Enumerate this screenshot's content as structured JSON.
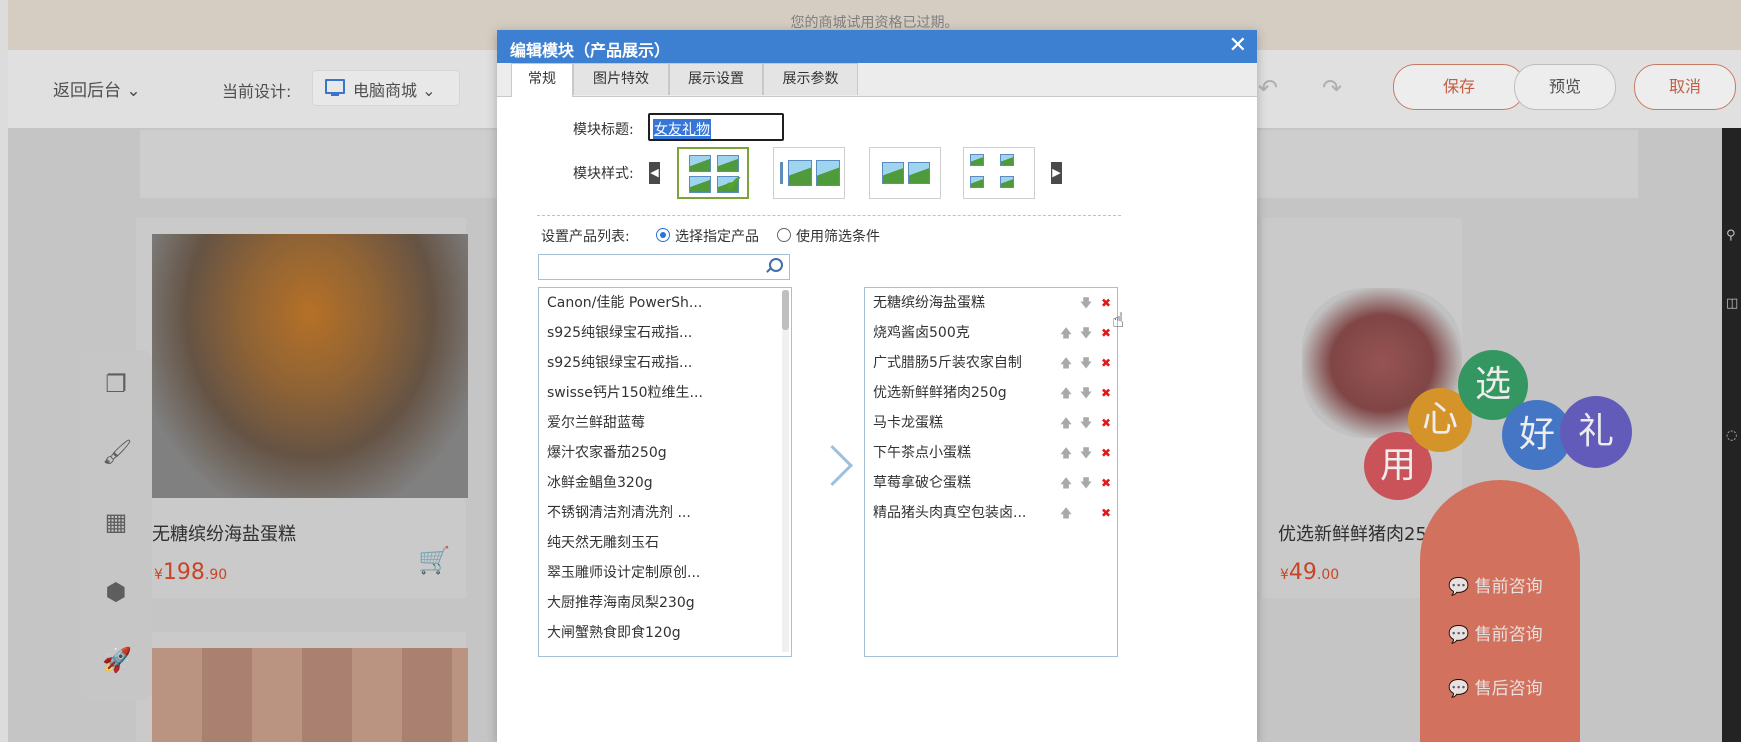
{
  "notice": {
    "text": "您的商城试用资格已过期。"
  },
  "editor_bar": {
    "back_label": "返回后台 ⌄",
    "current_design_label": "当前设计:",
    "device_label": "电脑商城 ⌄",
    "undo": "↶",
    "redo": "↷",
    "save_label": "保存",
    "preview_label": "预览",
    "cancel_label": "取消"
  },
  "background_products": [
    {
      "name": "无糖缤纷海盐蛋糕",
      "currency": "¥",
      "price_int": "198",
      "price_dec": ".90"
    },
    {
      "name": "优选新鲜鲜猪肉25",
      "currency": "¥",
      "price_int": "49",
      "price_dec": ".00"
    }
  ],
  "balloons": [
    "用",
    "心",
    "选",
    "好",
    "礼"
  ],
  "consult_items": [
    "售前咨询",
    "售前咨询",
    "售后咨询"
  ],
  "dialog": {
    "title": "编辑模块（产品展示）",
    "close_label": "✕",
    "tabs": [
      {
        "label": "常规",
        "active": true
      },
      {
        "label": "图片特效",
        "active": false
      },
      {
        "label": "展示设置",
        "active": false
      },
      {
        "label": "展示参数",
        "active": false
      }
    ],
    "module_title_label": "模块标题:",
    "module_title_value": "女友礼物",
    "module_style_label": "模块样式:",
    "prev_arrow": "◀",
    "next_arrow": "▶",
    "product_list_label": "设置产品列表:",
    "radio_specified": "选择指定产品",
    "radio_filter": "使用筛选条件",
    "search_placeholder": "",
    "available_products": [
      "Canon/佳能 PowerSh...",
      "s925纯银绿宝石戒指...",
      "s925纯银绿宝石戒指...",
      "swisse钙片150粒维生...",
      "爱尔兰鲜甜蓝莓",
      "爆汁农家番茄250g",
      "冰鲜金鲳鱼320g",
      "不锈钢清洁剂清洗剂 ...",
      "纯天然无雕刻玉石",
      "翠玉雕师设计定制原创...",
      "大厨推荐海南凤梨230g",
      "大闸蟹熟食即食120g"
    ],
    "selected_products": [
      {
        "name": "无糖缤纷海盐蛋糕",
        "up": false,
        "down": true
      },
      {
        "name": "烧鸡酱卤500克",
        "up": true,
        "down": true
      },
      {
        "name": "广式腊肠5斤装农家自制",
        "up": true,
        "down": true
      },
      {
        "name": "优选新鲜鲜猪肉250g",
        "up": true,
        "down": true
      },
      {
        "name": "马卡龙蛋糕",
        "up": true,
        "down": true
      },
      {
        "name": "下午茶点小蛋糕",
        "up": true,
        "down": true
      },
      {
        "name": "草莓拿破仑蛋糕",
        "up": true,
        "down": true
      },
      {
        "name": "精品猪头肉真空包装卤...",
        "up": true,
        "down": false
      }
    ],
    "icons": {
      "up": "🡅",
      "down": "🡇",
      "delete": "✖"
    }
  }
}
